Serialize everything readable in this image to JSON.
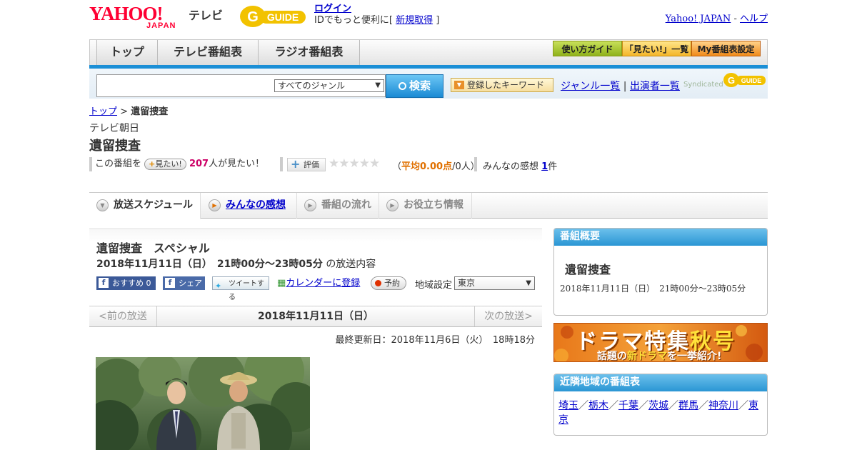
{
  "header": {
    "yahoo_logo": "YAHOO!",
    "yahoo_logo_sub": "JAPAN",
    "tv_label": "テレビ",
    "gguide_logo": "G-GUIDE",
    "login_link": "ログイン",
    "login_text": "IDでもっと便利に[",
    "register_link": "新規取得",
    "register_close": "]",
    "yahoo_japan_link": "Yahoo! JAPAN",
    "separator": "-",
    "help_link": "ヘルプ"
  },
  "nav": {
    "tabs": [
      "トップ",
      "テレビ番組表",
      "ラジオ番組表"
    ],
    "guide_buttons": [
      "使い方ガイド",
      "「見たい!」一覧",
      "My番組表設定"
    ]
  },
  "search": {
    "genre_selected": "すべてのジャンル",
    "search_button": "検索",
    "keyword_button": "登録したキーワード",
    "genre_list_link": "ジャンル一覧",
    "link_separator": "|",
    "cast_list_link": "出演者一覧",
    "syndicated": "Syndicated"
  },
  "breadcrumb": {
    "home": "トップ",
    "sep": ">",
    "current": "遺留捜査"
  },
  "program": {
    "station": "テレビ朝日",
    "title": "遺留捜査"
  },
  "stats": {
    "prefix": "この番組を",
    "want_pill": "見たい!",
    "want_count": "207",
    "want_suffix": "人が見たい！",
    "rating_button": "評価",
    "stars": "★★★★★",
    "avg_open": "（",
    "avg_label": "平均0.00点",
    "avg_count": "/0人",
    "avg_close": "）",
    "impressions_label": "みんなの感想",
    "impressions_count": "1",
    "impressions_suffix": "件"
  },
  "tabs": [
    "放送スケジュール",
    "みんなの感想",
    "番組の流れ",
    "お役立ち情報"
  ],
  "content": {
    "title": "遺留捜査　スペシャル",
    "time": "2018年11月11日（日）　21時00分～23時05分",
    "time_suffix": "の放送内容",
    "recommend_button": "おすすめ",
    "recommend_count": "0",
    "share_button": "シェア",
    "tweet_button": "ツイートする",
    "calendar_link": "カレンダーに登録",
    "reserve_button": "予約",
    "region_label": "地域設定",
    "region_selected": "東京",
    "prev_broadcast": "<前の放送",
    "current_date": "2018年11月11日（日）",
    "next_broadcast": "次の放送>",
    "updated": "最終更新日：2018年11月6日（火）　18時18分"
  },
  "sidebar": {
    "overview_heading": "番組概要",
    "overview_title": "遺留捜査",
    "overview_time": "2018年11月11日（日）　21時00分～23時05分",
    "drama_banner_main": "ドラマ特集",
    "drama_banner_aki": "秋号",
    "drama_banner_sub_a": "話題の",
    "drama_banner_sub_b": "新ドラマ",
    "drama_banner_sub_c": "を一挙紹介!",
    "nearby_heading": "近隣地域の番組表",
    "nearby_regions": [
      "埼玉",
      "栃木",
      "千葉",
      "茨城",
      "群馬",
      "神奈川",
      "東京"
    ],
    "nearby_sep": "／"
  },
  "colors": {
    "accent_blue": "#1b8fd6",
    "link": "#0000cc",
    "brand_red": "#ff0033",
    "want_count": "#cc0066",
    "rating_orange": "#e07000"
  }
}
